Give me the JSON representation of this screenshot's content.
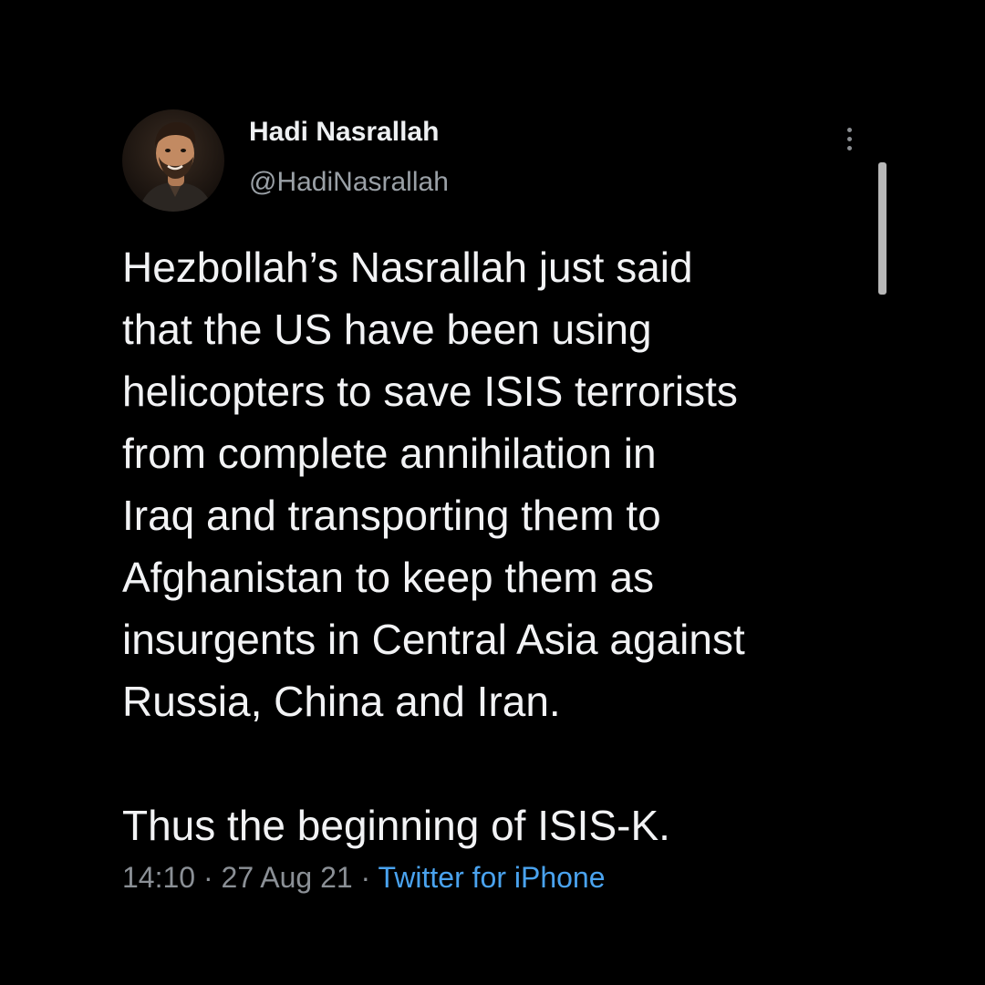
{
  "author": {
    "display_name": "Hadi Nasrallah",
    "handle": "@HadiNasrallah"
  },
  "tweet": {
    "lines": [
      "Hezbollah’s Nasrallah just said",
      "that the US have been using",
      "helicopters to save ISIS terrorists",
      "from complete annihilation in",
      "Iraq and transporting them to",
      "Afghanistan to keep them as",
      "insurgents in Central Asia against",
      "Russia, China and Iran."
    ],
    "closing_line": "Thus the beginning of ISIS-K."
  },
  "meta": {
    "time": "14:10",
    "separator_1": " · ",
    "date": "27 Aug 21",
    "separator_2": " · ",
    "source": "Twitter for iPhone"
  },
  "icons": {
    "more": "more-vertical-icon"
  },
  "colors": {
    "background": "#000000",
    "text": "#f2f3f5",
    "secondary_text": "#8b9096",
    "link": "#4aa3ef"
  }
}
